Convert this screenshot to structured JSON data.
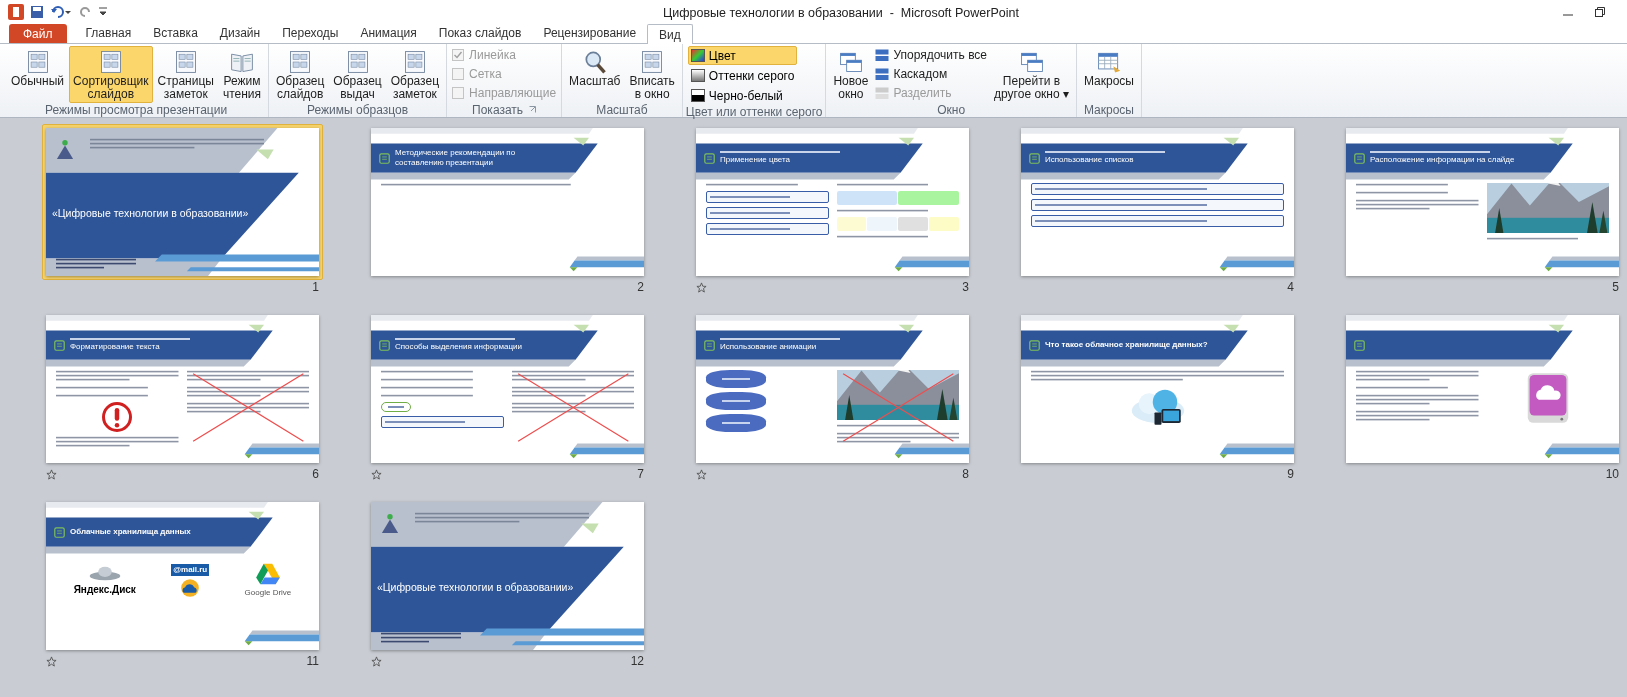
{
  "window": {
    "title": "Цифровые технологии в образовании  -  Microsoft PowerPoint"
  },
  "tabs": [
    {
      "label": "Файл",
      "kind": "file",
      "selected": false
    },
    {
      "label": "Главная",
      "kind": "tab",
      "selected": false
    },
    {
      "label": "Вставка",
      "kind": "tab",
      "selected": false
    },
    {
      "label": "Дизайн",
      "kind": "tab",
      "selected": false
    },
    {
      "label": "Переходы",
      "kind": "tab",
      "selected": false
    },
    {
      "label": "Анимация",
      "kind": "tab",
      "selected": false
    },
    {
      "label": "Показ слайдов",
      "kind": "tab",
      "selected": false
    },
    {
      "label": "Рецензирование",
      "kind": "tab",
      "selected": false
    },
    {
      "label": "Вид",
      "kind": "tab",
      "selected": true
    }
  ],
  "ribbon_groups": [
    {
      "label": "Режимы просмотра презентации",
      "items": [
        {
          "kind": "large",
          "lines": [
            "Обычный"
          ],
          "selected": false
        },
        {
          "kind": "large",
          "lines": [
            "Сортировщик",
            "слайдов"
          ],
          "selected": true
        },
        {
          "kind": "large",
          "lines": [
            "Страницы",
            "заметок"
          ],
          "selected": false
        },
        {
          "kind": "large",
          "lines": [
            "Режим",
            "чтения"
          ],
          "selected": false
        }
      ]
    },
    {
      "label": "Режимы образцов",
      "items": [
        {
          "kind": "large",
          "lines": [
            "Образец",
            "слайдов"
          ],
          "selected": false
        },
        {
          "kind": "large",
          "lines": [
            "Образец",
            "выдач"
          ],
          "selected": false
        },
        {
          "kind": "large",
          "lines": [
            "Образец",
            "заметок"
          ],
          "selected": false
        }
      ]
    },
    {
      "label": "Показать",
      "launcher": true,
      "items": [
        {
          "kind": "check",
          "label": "Линейка",
          "checked": true,
          "disabled": true
        },
        {
          "kind": "check",
          "label": "Сетка",
          "checked": false,
          "disabled": true
        },
        {
          "kind": "check",
          "label": "Направляющие",
          "checked": false,
          "disabled": true
        }
      ]
    },
    {
      "label": "Масштаб",
      "items": [
        {
          "kind": "large",
          "lines": [
            "Масштаб"
          ],
          "selected": false
        },
        {
          "kind": "large",
          "lines": [
            "Вписать",
            "в окно"
          ],
          "selected": false
        }
      ]
    },
    {
      "label": "Цвет или оттенки серого",
      "items": [
        {
          "kind": "option",
          "label": "Цвет",
          "selected": true
        },
        {
          "kind": "option",
          "label": "Оттенки серого",
          "selected": false
        },
        {
          "kind": "option",
          "label": "Черно-белый",
          "selected": false
        }
      ]
    },
    {
      "label": "Окно",
      "items": [
        {
          "kind": "large",
          "lines": [
            "Новое",
            "окно"
          ],
          "selected": false
        },
        {
          "kind": "small",
          "label": "Упорядочить все",
          "disabled": false
        },
        {
          "kind": "small",
          "label": "Каскадом",
          "disabled": false
        },
        {
          "kind": "small",
          "label": "Разделить",
          "disabled": true
        },
        {
          "kind": "large",
          "lines": [
            "Перейти в",
            "другое окно ▾"
          ],
          "selected": false
        }
      ]
    },
    {
      "label": "Макросы",
      "items": [
        {
          "kind": "large",
          "lines": [
            "Макросы"
          ],
          "selected": false
        }
      ]
    }
  ],
  "slides": [
    {
      "number": "1",
      "selected": true,
      "transition": false,
      "kind": "cover",
      "title": "«Цифровые технологии в образовании»"
    },
    {
      "number": "2",
      "selected": false,
      "transition": false,
      "kind": "content",
      "header": false,
      "title": "Методические рекомендации по составлению презентации",
      "left": [
        {
          "kind": "line"
        }
      ]
    },
    {
      "number": "3",
      "selected": false,
      "transition": true,
      "kind": "content",
      "header": true,
      "title": "Применение цвета",
      "left": [
        {
          "kind": "line"
        },
        {
          "kind": "box"
        },
        {
          "kind": "box"
        },
        {
          "kind": "box"
        }
      ],
      "right": [
        {
          "kind": "line"
        },
        {
          "kind": "swatches",
          "items": [
            {
              "color": "#cfe3f8"
            },
            {
              "color": "#a9f59f"
            }
          ]
        },
        {
          "kind": "line"
        },
        {
          "kind": "swatches",
          "items": [
            {
              "color": "#fdfbd2"
            },
            {
              "color": "#eef6fb"
            },
            {
              "color": "#e0e0e0"
            },
            {
              "color": "#fdfcc6"
            }
          ]
        },
        {
          "kind": "line"
        }
      ]
    },
    {
      "number": "4",
      "selected": false,
      "transition": false,
      "kind": "content",
      "header": true,
      "title": "Использование списков",
      "left": [
        {
          "kind": "box"
        },
        {
          "kind": "box"
        },
        {
          "kind": "box"
        }
      ]
    },
    {
      "number": "5",
      "selected": false,
      "transition": false,
      "kind": "content",
      "header": true,
      "title": "Расположение информации на слайде",
      "left": [
        {
          "kind": "line"
        },
        {
          "kind": "line"
        },
        {
          "kind": "paragraph"
        }
      ],
      "right": [
        {
          "kind": "picture"
        },
        {
          "kind": "line"
        }
      ]
    },
    {
      "number": "6",
      "selected": false,
      "transition": true,
      "kind": "content",
      "header": true,
      "title": "Форматирование текста",
      "crossed": true,
      "left": [
        {
          "kind": "paragraph"
        },
        {
          "kind": "line"
        },
        {
          "kind": "line"
        },
        {
          "kind": "warning"
        },
        {
          "kind": "paragraph"
        }
      ],
      "right": [
        {
          "kind": "paragraph"
        },
        {
          "kind": "paragraph"
        },
        {
          "kind": "paragraph"
        }
      ]
    },
    {
      "number": "7",
      "selected": false,
      "transition": true,
      "kind": "content",
      "header": true,
      "title": "Способы выделения информации",
      "crossed": true,
      "left": [
        {
          "kind": "line"
        },
        {
          "kind": "line"
        },
        {
          "kind": "line"
        },
        {
          "kind": "line"
        },
        {
          "kind": "oval"
        },
        {
          "kind": "box"
        }
      ],
      "right": [
        {
          "kind": "paragraph"
        },
        {
          "kind": "paragraph"
        },
        {
          "kind": "paragraph"
        }
      ]
    },
    {
      "number": "8",
      "selected": false,
      "transition": true,
      "kind": "content",
      "header": true,
      "title": "Использование анимации",
      "crossed": true,
      "left": [
        {
          "kind": "shape"
        },
        {
          "kind": "shape"
        },
        {
          "kind": "shape"
        }
      ],
      "right": [
        {
          "kind": "picture"
        },
        {
          "kind": "line"
        },
        {
          "kind": "paragraph"
        }
      ]
    },
    {
      "number": "9",
      "selected": false,
      "transition": false,
      "kind": "content",
      "header": false,
      "title": "Что такое облачное хранилище данных?",
      "left": [
        {
          "kind": "paragraph"
        },
        {
          "kind": "cloud"
        }
      ]
    },
    {
      "number": "10",
      "selected": false,
      "transition": false,
      "kind": "content",
      "header": false,
      "left": [
        {
          "kind": "paragraph"
        },
        {
          "kind": "line"
        },
        {
          "kind": "paragraph"
        },
        {
          "kind": "paragraph"
        }
      ],
      "right": [
        {
          "kind": "drive"
        }
      ]
    },
    {
      "number": "11",
      "selected": false,
      "transition": true,
      "kind": "content",
      "header": false,
      "title": "Облачные хранилища данных",
      "left": [
        {
          "kind": "logos",
          "items": [
            "Яндекс.Диск",
            "@mail.ru",
            "Google Drive"
          ]
        }
      ]
    },
    {
      "number": "12",
      "selected": false,
      "transition": true,
      "kind": "cover",
      "title": "«Цифровые технологии в образовании»"
    }
  ]
}
